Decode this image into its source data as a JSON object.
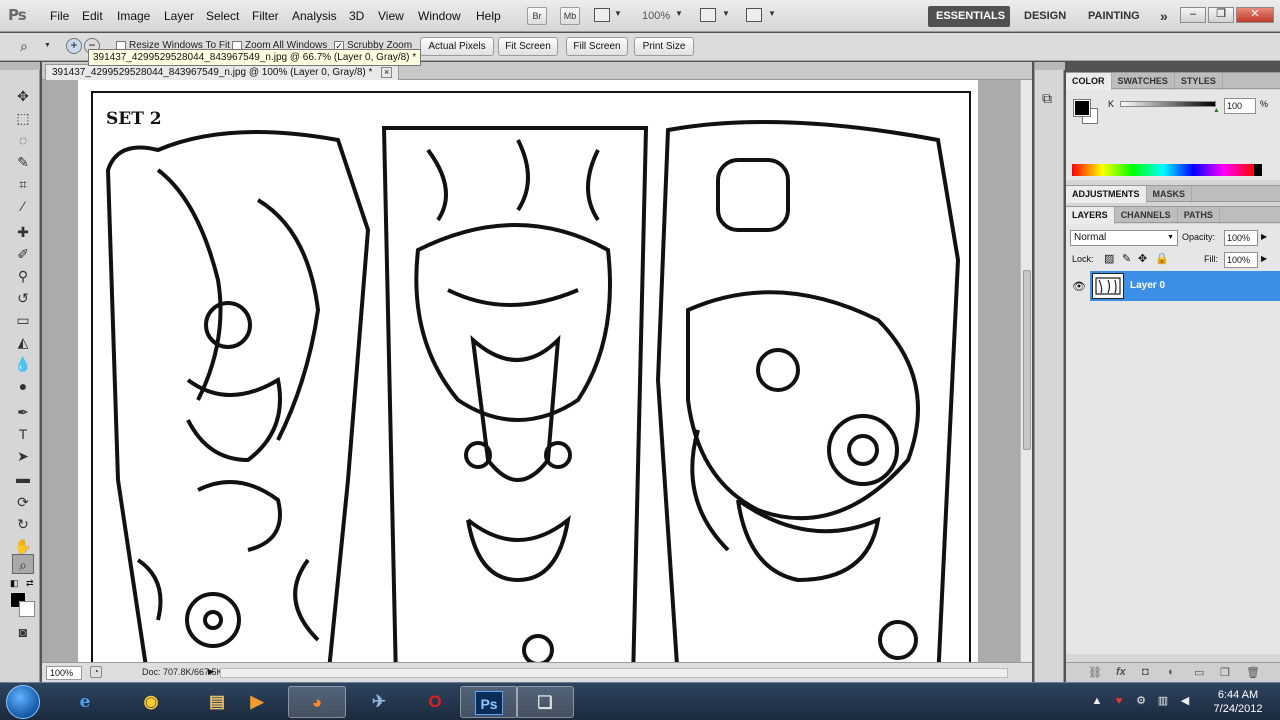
{
  "app": {
    "logo": "Ps"
  },
  "menu": [
    "File",
    "Edit",
    "Image",
    "Layer",
    "Select",
    "Filter",
    "Analysis",
    "3D",
    "View",
    "Window",
    "Help"
  ],
  "appbar": {
    "bridge": "Br",
    "mini_bridge": "Mb",
    "zoom": "100%"
  },
  "workspaces": {
    "essentials": "ESSENTIALS",
    "design": "DESIGN",
    "painting": "PAINTING",
    "more": "»"
  },
  "options": {
    "resize_windows": "Resize Windows To Fit",
    "zoom_all": "Zoom All Windows",
    "scrubby": "Scrubby Zoom",
    "actual_pixels": "Actual Pixels",
    "fit_screen": "Fit Screen",
    "fill_screen": "Fill Screen",
    "print_size": "Print Size"
  },
  "tooltip": "391437_4299529528044_843967549_n.jpg @ 66.7% (Layer 0, Gray/8) *",
  "document": {
    "tab_title": "391437_4299529528044_843967549_n.jpg @ 100% (Layer 0, Gray/8) *",
    "tab_close": "×",
    "artwork_label": "SET 2",
    "zoom": "100%",
    "doc_info": "Doc: 707.8K/667.5K"
  },
  "color_panel": {
    "tabs": [
      "COLOR",
      "SWATCHES",
      "STYLES"
    ],
    "channel": "K",
    "value": "100",
    "unit": "%",
    "k_level": 1.0
  },
  "adjust_panel": {
    "tabs": [
      "ADJUSTMENTS",
      "MASKS"
    ]
  },
  "layers_panel": {
    "tabs": [
      "LAYERS",
      "CHANNELS",
      "PATHS"
    ],
    "blend_mode": "Normal",
    "opacity_label": "Opacity:",
    "opacity": "100%",
    "lock_label": "Lock:",
    "fill_label": "Fill:",
    "fill": "100%",
    "layer_name": "Layer 0"
  },
  "taskbar": {
    "ps_label": "Ps",
    "time": "6:44 AM",
    "date": "7/24/2012"
  },
  "colors": {
    "accent": "#3c8fe6",
    "essentials_bg": "#515151"
  }
}
